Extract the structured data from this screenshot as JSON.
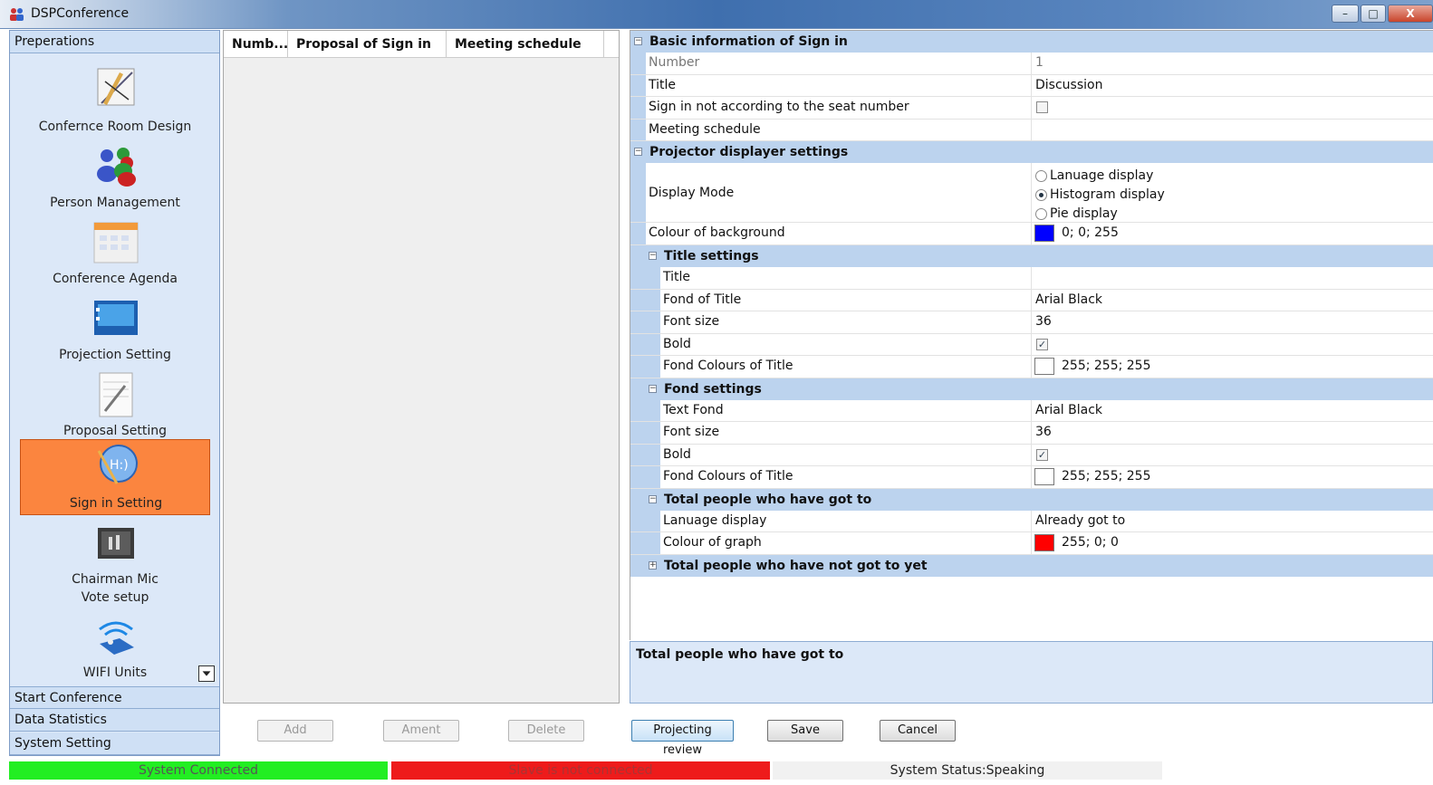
{
  "window": {
    "title": "DSPConference",
    "minimize_glyph": "–",
    "maximize_glyph": "□",
    "close_glyph": "X"
  },
  "nav": {
    "sections": {
      "preparations": "Preperations",
      "start": "Start Conference",
      "data": "Data Statistics",
      "system": "System Setting"
    },
    "items": [
      {
        "label": "Confernce Room Design",
        "icon": "drafting-tools-icon"
      },
      {
        "label": "Person Management",
        "icon": "people-icon"
      },
      {
        "label": "Conference Agenda",
        "icon": "calendar-icon"
      },
      {
        "label": "Projection Setting",
        "icon": "projection-screen-icon"
      },
      {
        "label": "Proposal Setting",
        "icon": "document-pen-icon"
      },
      {
        "label": "Sign in Setting",
        "icon": "sign-in-icon",
        "selected": true
      },
      {
        "label": "Chairman Mic",
        "label2": "Vote setup",
        "icon": "microphone-unit-icon"
      },
      {
        "label": "WIFI Units",
        "icon": "wifi-router-icon"
      }
    ]
  },
  "list": {
    "columns": [
      "Numb...",
      "Proposal of Sign in",
      "Meeting schedule"
    ]
  },
  "buttons": {
    "add": "Add",
    "ament": "Ament",
    "delete": "Delete",
    "review": "Projecting review",
    "save": "Save",
    "cancel": "Cancel"
  },
  "props": {
    "basic": {
      "header": "Basic information of Sign in",
      "number_label": "Number",
      "number_value": "1",
      "title_label": "Title",
      "title_value": "Discussion",
      "seat_label": "Sign in not according to the seat number",
      "schedule_label": "Meeting schedule"
    },
    "projector": {
      "header": "Projector displayer settings",
      "mode_label": "Display Mode",
      "mode_options": [
        "Lanuage display",
        "Histogram display",
        "Pie display"
      ],
      "mode_selected": "Histogram display",
      "bg_label": "Colour of background",
      "bg_value": "0; 0; 255",
      "bg_color": "#0000ff"
    },
    "title_settings": {
      "header": "Title settings",
      "title_label": "Title",
      "font_label": "Fond of Title",
      "font_value": "Arial Black",
      "size_label": "Font size",
      "size_value": "36",
      "bold_label": "Bold",
      "bold_checked": true,
      "color_label": "Fond Colours of Title",
      "color_value": "255; 255; 255",
      "color_hex": "#ffffff"
    },
    "font_settings": {
      "header": "Fond settings",
      "font_label": "Text Fond",
      "font_value": "Arial Black",
      "size_label": "Font size",
      "size_value": "36",
      "bold_label": "Bold",
      "bold_checked": true,
      "color_label": "Fond Colours of Title",
      "color_value": "255; 255; 255",
      "color_hex": "#ffffff"
    },
    "got_to": {
      "header": "Total people who have got to",
      "lang_label": "Lanuage display",
      "lang_value": "Already got to",
      "graph_label": "Colour of graph",
      "graph_value": "255; 0; 0",
      "graph_color": "#ff0000"
    },
    "not_got_to": {
      "header": "Total people who have not got to yet"
    }
  },
  "description": {
    "title": "Total people who have got to"
  },
  "status": {
    "connected": "System Connected",
    "slave": "Slave is not connected",
    "system": "System Status:Speaking"
  }
}
